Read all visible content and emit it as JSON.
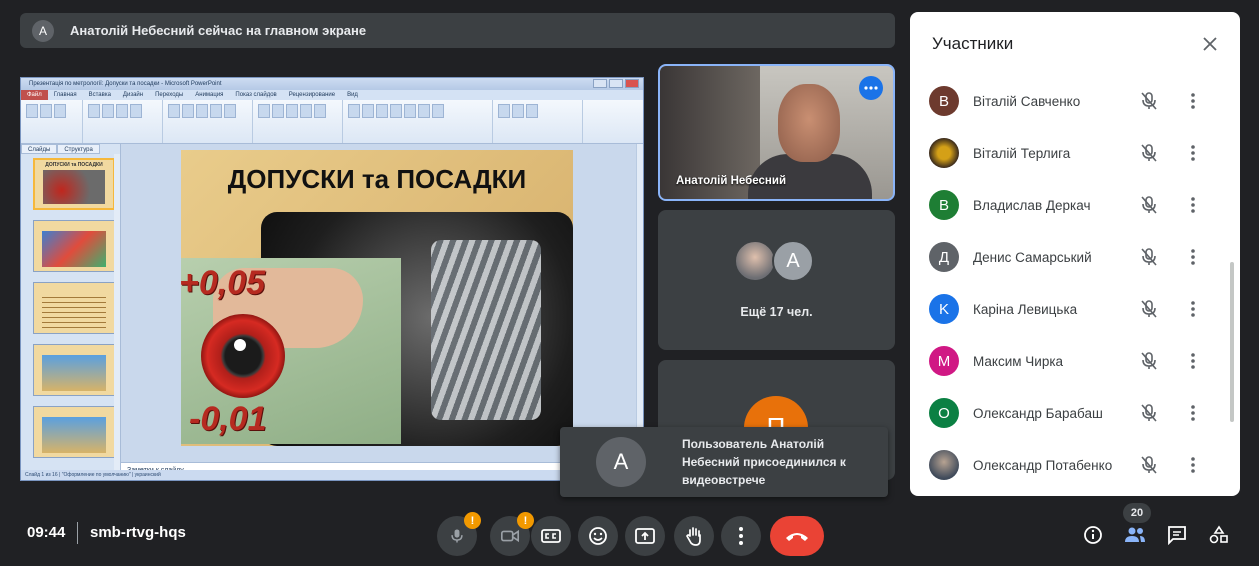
{
  "banner": {
    "avatar_letter": "A",
    "text": "Анатолій Небесний сейчас на главном экране"
  },
  "presentation": {
    "window_title": "Презентація по метрології: Допуски та посадки - Microsoft PowerPoint",
    "ribbon_tabs": [
      "Файл",
      "Главная",
      "Вставка",
      "Дизайн",
      "Переходы",
      "Анимация",
      "Показ слайдов",
      "Рецензирование",
      "Вид"
    ],
    "side_tabs": [
      "Слайды",
      "Структура"
    ],
    "slide_title": "ДОПУСКИ та ПОСАДКИ",
    "tolerance_plus": "+0,05",
    "tolerance_minus": "-0,01",
    "thumb_title": "ДОПУСКИ та ПОСАДКИ",
    "notes_placeholder": "Заметки к слайду",
    "status_text": "Слайд 1 из 16 | \"Оформление по умолчанию\" | украинский"
  },
  "tiles": {
    "presenter_name": "Анатолій Небесний",
    "group_letter": "A",
    "more_people": "Ещё 17 чел.",
    "third_letter": "П"
  },
  "toast": {
    "avatar_letter": "A",
    "message": "Пользователь Анатолій Небесний присоединился к видеовстрече"
  },
  "participants": {
    "title": "Участники",
    "items": [
      {
        "letter": "В",
        "name": "Віталій Савченко",
        "color": "#6d3a2e"
      },
      {
        "letter": "",
        "name": "Віталій Терлига",
        "color": "#3a2a1c"
      },
      {
        "letter": "В",
        "name": "Владислав Деркач",
        "color": "#1e7e34"
      },
      {
        "letter": "Д",
        "name": "Денис Самарський",
        "color": "#5f6368"
      },
      {
        "letter": "K",
        "name": "Каріна Левицька",
        "color": "#1a73e8"
      },
      {
        "letter": "M",
        "name": "Максим Чирка",
        "color": "#d01884"
      },
      {
        "letter": "O",
        "name": "Олександр Барабаш",
        "color": "#0b8043"
      },
      {
        "letter": "",
        "name": "Олександр Потабенко",
        "color": "#7a7f86"
      }
    ]
  },
  "bottom_bar": {
    "time": "09:44",
    "meeting_code": "smb-rtvg-hqs",
    "participant_count": "20",
    "warning_mark": "!"
  },
  "colors": {
    "accent_blue": "#1a73e8",
    "end_call_red": "#ea4335",
    "warning_orange": "#f29900"
  }
}
